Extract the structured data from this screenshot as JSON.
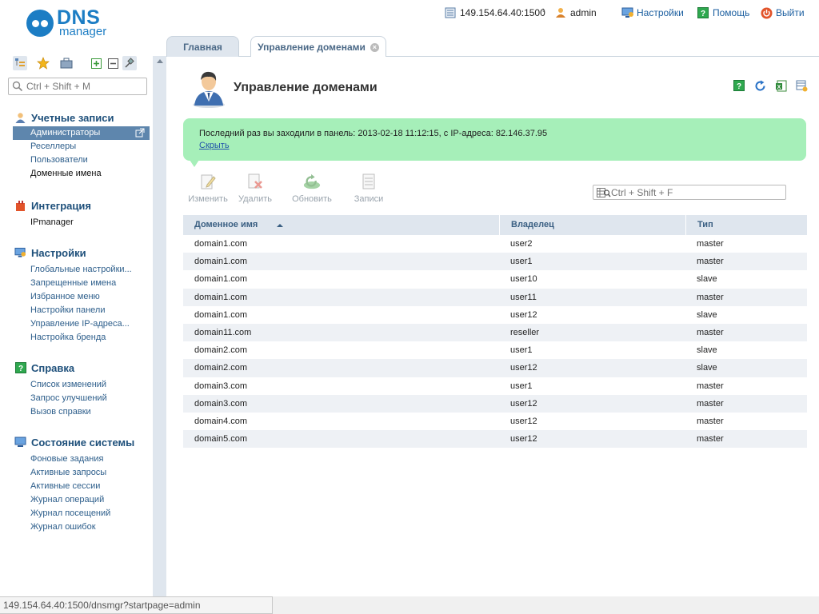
{
  "logo": {
    "line1": "DNS",
    "line2": "manager"
  },
  "topbar": {
    "server": "149.154.64.40:1500",
    "user": "admin",
    "settings": "Настройки",
    "help": "Помощь",
    "exit": "Выйти"
  },
  "sidebar": {
    "search_placeholder": "Ctrl + Shift + M",
    "groups": [
      {
        "title": "Учетные записи",
        "items": [
          "Администраторы",
          "Реселлеры",
          "Пользователи",
          "Доменные имена"
        ]
      },
      {
        "title": "Интеграция",
        "items": [
          "IPmanager"
        ]
      },
      {
        "title": "Настройки",
        "items": [
          "Глобальные настройки...",
          "Запрещенные имена",
          "Избранное меню",
          "Настройки панели",
          "Управление IP-адреса...",
          "Настройка бренда"
        ]
      },
      {
        "title": "Справка",
        "items": [
          "Список изменений",
          "Запрос улучшений",
          "Вызов справки"
        ]
      },
      {
        "title": "Состояние системы",
        "items": [
          "Фоновые задания",
          "Активные запросы",
          "Активные сессии",
          "Журнал операций",
          "Журнал посещений",
          "Журнал ошибок"
        ]
      }
    ]
  },
  "tabs": {
    "home": "Главная",
    "domains": "Управление доменами"
  },
  "main": {
    "title": "Управление доменами",
    "notice": {
      "text": "Последний раз вы заходили в панель: 2013-02-18 11:12:15, с IP-адреса: 82.146.37.95",
      "hide": "Скрыть"
    },
    "actions": {
      "edit": "Изменить",
      "delete": "Удалить",
      "refresh": "Обновить",
      "records": "Записи"
    },
    "filter_placeholder": "Ctrl + Shift + F",
    "table": {
      "headers": [
        "Доменное имя",
        "Владелец",
        "Тип"
      ],
      "rows": [
        [
          "domain1.com",
          "user2",
          "master"
        ],
        [
          "domain1.com",
          "user1",
          "master"
        ],
        [
          "domain1.com",
          "user10",
          "slave"
        ],
        [
          "domain1.com",
          "user11",
          "master"
        ],
        [
          "domain1.com",
          "user12",
          "slave"
        ],
        [
          "domain11.com",
          "reseller",
          "master"
        ],
        [
          "domain2.com",
          "user1",
          "slave"
        ],
        [
          "domain2.com",
          "user12",
          "slave"
        ],
        [
          "domain3.com",
          "user1",
          "master"
        ],
        [
          "domain3.com",
          "user12",
          "master"
        ],
        [
          "domain4.com",
          "user12",
          "master"
        ],
        [
          "domain5.com",
          "user12",
          "master"
        ]
      ]
    }
  },
  "statusbar": "149.154.64.40:1500/dnsmgr?startpage=admin"
}
